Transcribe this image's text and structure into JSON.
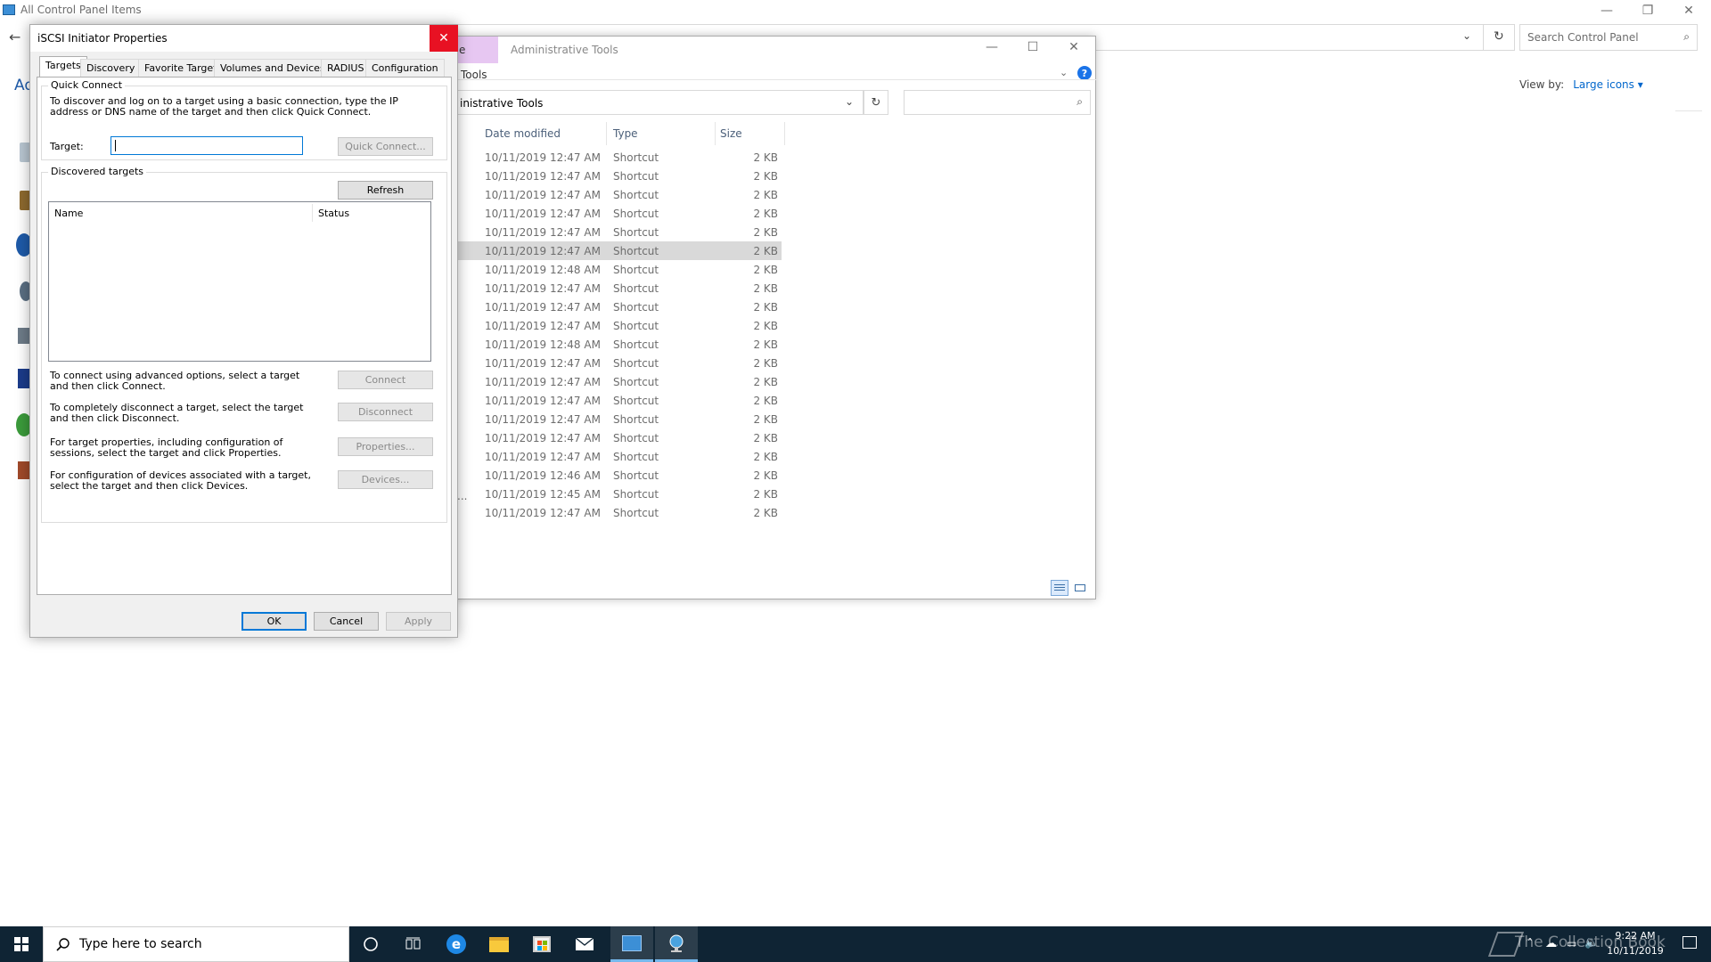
{
  "control_panel": {
    "title": "All Control Panel Items",
    "search_placeholder": "Search Control Panel",
    "view_by_label": "View by:",
    "view_by_value": "Large icons ▾",
    "left_header_fragment": "Ad"
  },
  "explorer": {
    "title": "Administrative Tools",
    "ribbon_tab_fragment": "e",
    "subtab_label": "Tools",
    "path": "inistrative Tools",
    "columns": {
      "date": "Date modified",
      "type": "Type",
      "size": "Size"
    },
    "rows": [
      {
        "date": "10/11/2019 12:47 AM",
        "type": "Shortcut",
        "size": "2 KB"
      },
      {
        "date": "10/11/2019 12:47 AM",
        "type": "Shortcut",
        "size": "2 KB"
      },
      {
        "date": "10/11/2019 12:47 AM",
        "type": "Shortcut",
        "size": "2 KB"
      },
      {
        "date": "10/11/2019 12:47 AM",
        "type": "Shortcut",
        "size": "2 KB"
      },
      {
        "date": "10/11/2019 12:47 AM",
        "type": "Shortcut",
        "size": "2 KB"
      },
      {
        "date": "10/11/2019 12:47 AM",
        "type": "Shortcut",
        "size": "2 KB"
      },
      {
        "date": "10/11/2019 12:48 AM",
        "type": "Shortcut",
        "size": "2 KB"
      },
      {
        "date": "10/11/2019 12:47 AM",
        "type": "Shortcut",
        "size": "2 KB"
      },
      {
        "date": "10/11/2019 12:47 AM",
        "type": "Shortcut",
        "size": "2 KB"
      },
      {
        "date": "10/11/2019 12:47 AM",
        "type": "Shortcut",
        "size": "2 KB"
      },
      {
        "date": "10/11/2019 12:48 AM",
        "type": "Shortcut",
        "size": "2 KB"
      },
      {
        "date": "10/11/2019 12:47 AM",
        "type": "Shortcut",
        "size": "2 KB"
      },
      {
        "date": "10/11/2019 12:47 AM",
        "type": "Shortcut",
        "size": "2 KB"
      },
      {
        "date": "10/11/2019 12:47 AM",
        "type": "Shortcut",
        "size": "2 KB"
      },
      {
        "date": "10/11/2019 12:47 AM",
        "type": "Shortcut",
        "size": "2 KB"
      },
      {
        "date": "10/11/2019 12:47 AM",
        "type": "Shortcut",
        "size": "2 KB"
      },
      {
        "date": "10/11/2019 12:47 AM",
        "type": "Shortcut",
        "size": "2 KB"
      },
      {
        "date": "10/11/2019 12:46 AM",
        "type": "Shortcut",
        "size": "2 KB"
      },
      {
        "date": "10/11/2019 12:45 AM",
        "type": "Shortcut",
        "size": "2 KB"
      },
      {
        "date": "10/11/2019 12:47 AM",
        "type": "Shortcut",
        "size": "2 KB"
      }
    ],
    "selected_row": 5,
    "ellipsis_fragment": "..."
  },
  "dialog": {
    "title": "iSCSI Initiator Properties",
    "tabs": [
      "Targets",
      "Discovery",
      "Favorite Targets",
      "Volumes and Devices",
      "RADIUS",
      "Configuration"
    ],
    "quick_connect": {
      "group_label": "Quick Connect",
      "description": "To discover and log on to a target using a basic connection, type the IP address or DNS name of the target and then click Quick Connect.",
      "target_label": "Target:",
      "target_value": "",
      "button": "Quick Connect..."
    },
    "discovered": {
      "group_label": "Discovered targets",
      "refresh_button": "Refresh",
      "col_name": "Name",
      "col_status": "Status"
    },
    "actions": [
      {
        "text": "To connect using advanced options, select a target and then click Connect.",
        "button": "Connect"
      },
      {
        "text": "To completely disconnect a target, select the target and then click Disconnect.",
        "button": "Disconnect"
      },
      {
        "text": "For target properties, including configuration of sessions, select the target and click Properties.",
        "button": "Properties..."
      },
      {
        "text": "For configuration of devices associated with a target, select the target and then click Devices.",
        "button": "Devices..."
      }
    ],
    "ok": "OK",
    "cancel": "Cancel",
    "apply": "Apply"
  },
  "taskbar": {
    "search_placeholder": "Type here to search",
    "time": "9:22 AM",
    "date": "10/11/2019",
    "watermark": "The Collection Book"
  },
  "colors": {
    "accent": "#0078d7",
    "close_red": "#e81123",
    "taskbar": "#0f2434",
    "ribbon_tab": "#e7c7f2",
    "link_blue": "#0066cc"
  }
}
